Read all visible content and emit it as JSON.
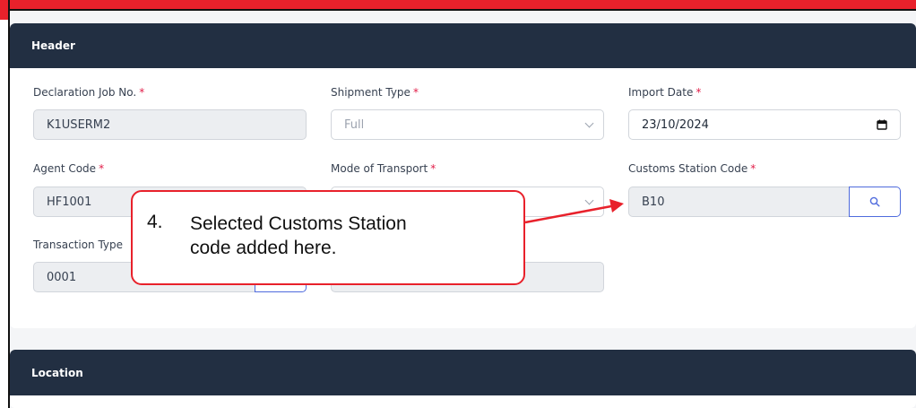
{
  "header_section": {
    "title": "Header",
    "required_mark": "*",
    "fields": {
      "declaration_job_no": {
        "label": "Declaration Job No.",
        "value": "K1USERM2"
      },
      "shipment_type": {
        "label": "Shipment Type",
        "value": "Full"
      },
      "import_date": {
        "label": "Import Date",
        "value": "23/10/2024"
      },
      "agent_code": {
        "label": "Agent Code",
        "value": "HF1001"
      },
      "mode_of_transport": {
        "label": "Mode of Transport",
        "value": ""
      },
      "customs_station_code": {
        "label": "Customs Station Code",
        "value": "B10"
      },
      "transaction_type": {
        "label": "Transaction Type",
        "value": "0001"
      }
    }
  },
  "location_section": {
    "title": "Location"
  },
  "annotation": {
    "number": "4.",
    "text_line1": "Selected Customs Station",
    "text_line2": "code added here.",
    "color": "#e8212b"
  },
  "icons": {
    "dropdown": "chevron-down-icon",
    "date": "calendar-icon",
    "search": "search-icon"
  }
}
